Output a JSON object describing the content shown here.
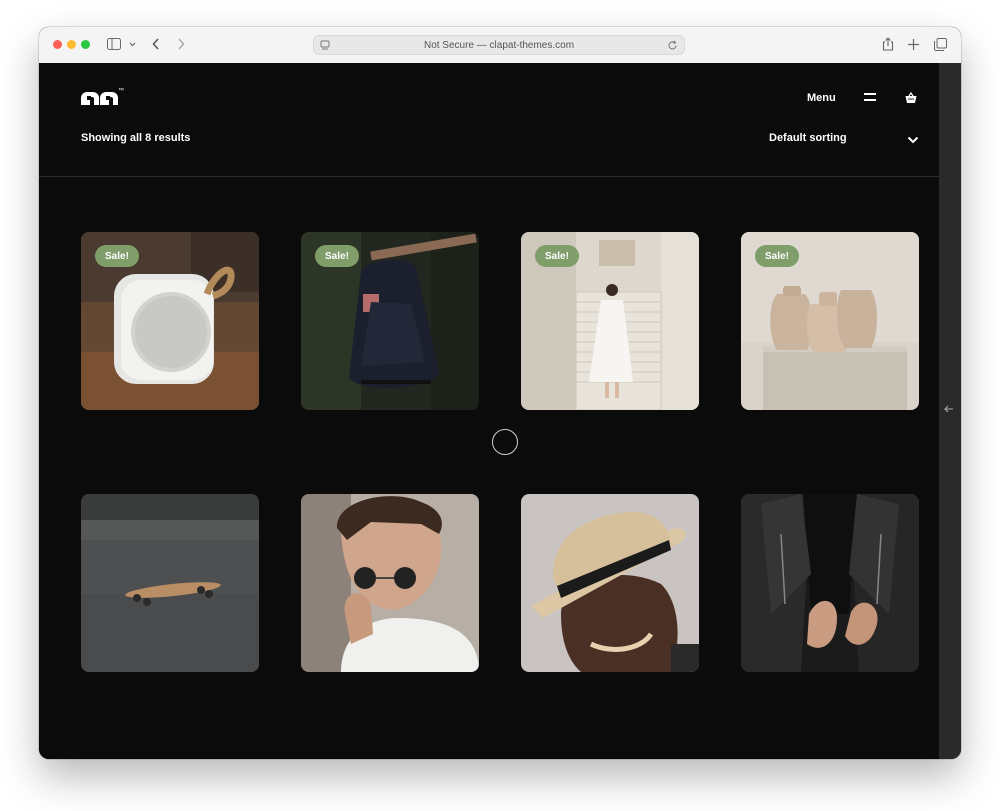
{
  "browser": {
    "address": "Not Secure — clapat-themes.com"
  },
  "header": {
    "logo_trademark": "™",
    "menu_label": "Menu"
  },
  "shop": {
    "results_text": "Showing all 8 results",
    "sorting_label": "Default sorting"
  },
  "products": [
    {
      "name": "white-speaker",
      "badge": "Sale!"
    },
    {
      "name": "black-backpack",
      "badge": "Sale!"
    },
    {
      "name": "woman-on-stairs",
      "badge": "Sale!"
    },
    {
      "name": "ceramic-vases",
      "badge": "Sale!"
    },
    {
      "name": "skateboard",
      "badge": ""
    },
    {
      "name": "man-sunglasses",
      "badge": ""
    },
    {
      "name": "man-hat",
      "badge": ""
    },
    {
      "name": "leather-jacket",
      "badge": ""
    }
  ],
  "colors": {
    "page_bg": "#0b0b0b",
    "badge_green": "#7f9e6a",
    "text": "#ffffff"
  },
  "icons": [
    "sidebar-icon",
    "chevron-left-icon",
    "chevron-right-icon",
    "reload-icon",
    "share-icon",
    "plus-icon",
    "tabs-icon",
    "hamburger-icon",
    "basket-icon",
    "chevron-down-icon",
    "arrow-left-icon",
    "loader-icon"
  ]
}
